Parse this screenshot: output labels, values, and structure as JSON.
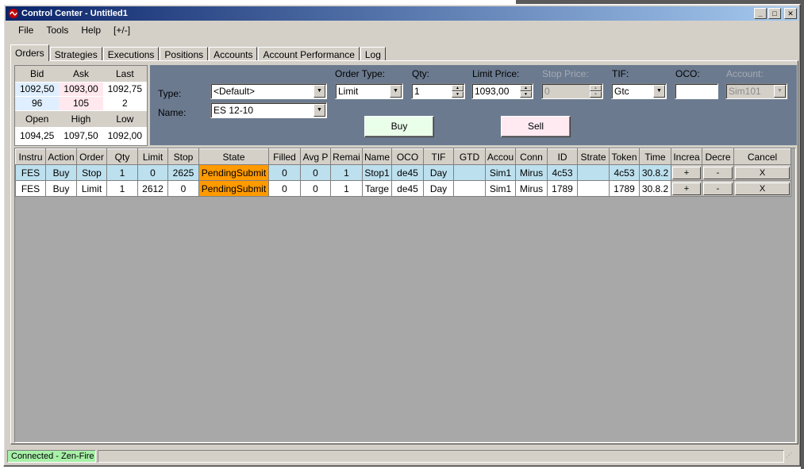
{
  "window": {
    "title": "Control Center - Untitled1"
  },
  "menu": [
    "File",
    "Tools",
    "Help",
    "[+/-]"
  ],
  "tabs": [
    "Orders",
    "Strategies",
    "Executions",
    "Positions",
    "Accounts",
    "Account Performance",
    "Log"
  ],
  "quote": {
    "headers1": [
      "Bid",
      "Ask",
      "Last"
    ],
    "prices": [
      "1092,50",
      "1093,00",
      "1092,75"
    ],
    "sizes": [
      "96",
      "105",
      "2"
    ],
    "headers2": [
      "Open",
      "High",
      "Low"
    ],
    "ohl": [
      "1094,25",
      "1097,50",
      "1092,00"
    ]
  },
  "entry": {
    "type_label": "Type:",
    "type_value": "<Default>",
    "name_label": "Name:",
    "name_value": "ES 12-10",
    "order_type_label": "Order Type:",
    "order_type_value": "Limit",
    "qty_label": "Qty:",
    "qty_value": "1",
    "limit_label": "Limit Price:",
    "limit_value": "1093,00",
    "stop_label": "Stop Price:",
    "stop_value": "0",
    "tif_label": "TIF:",
    "tif_value": "Gtc",
    "oco_label": "OCO:",
    "oco_value": "",
    "account_label": "Account:",
    "account_value": "Sim101",
    "buy_label": "Buy",
    "sell_label": "Sell"
  },
  "grid": {
    "columns": [
      "Instru",
      "Action",
      "Order",
      "Qty",
      "Limit",
      "Stop",
      "State",
      "Filled",
      "Avg P",
      "Remai",
      "Name",
      "OCO",
      "TIF",
      "GTD",
      "Accou",
      "Conn",
      "ID",
      "Strate",
      "Token",
      "Time",
      "Increa",
      "Decre",
      "Cancel"
    ],
    "rows": [
      {
        "instrument": "FES",
        "action": "Buy",
        "order": "Stop",
        "qty": "1",
        "limit": "0",
        "stop": "2625",
        "state": "PendingSubmit",
        "filled": "0",
        "avg": "0",
        "remaining": "1",
        "name": "Stop1",
        "oco": "de45",
        "tif": "Day",
        "gtd": "",
        "account": "Sim1",
        "conn": "Mirus",
        "id": "4c53",
        "strategy": "",
        "token": "4c53",
        "time": "30.8.2",
        "inc": "+",
        "dec": "-",
        "cancel": "X"
      },
      {
        "instrument": "FES",
        "action": "Buy",
        "order": "Limit",
        "qty": "1",
        "limit": "2612",
        "stop": "0",
        "state": "PendingSubmit",
        "filled": "0",
        "avg": "0",
        "remaining": "1",
        "name": "Targe",
        "oco": "de45",
        "tif": "Day",
        "gtd": "",
        "account": "Sim1",
        "conn": "Mirus",
        "id": "1789",
        "strategy": "",
        "token": "1789",
        "time": "30.8.2",
        "inc": "+",
        "dec": "-",
        "cancel": "X"
      }
    ]
  },
  "status": {
    "connection": "Connected - Zen-Fire"
  },
  "colors": {
    "title_start": "#0a246a",
    "title_end": "#a6caf0",
    "entry_panel": "#6b7a8f",
    "state_pending": "#ff9a00",
    "row_selected": "#bde0ee",
    "connected": "#a8f0a8"
  }
}
